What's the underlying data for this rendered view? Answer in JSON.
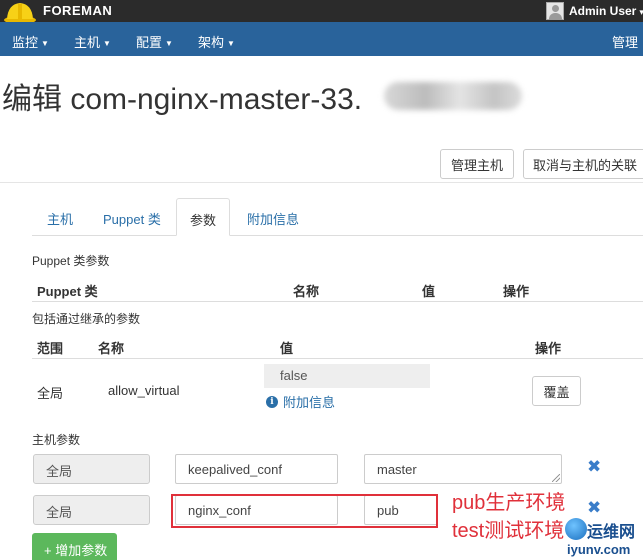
{
  "header": {
    "brand": "FOREMAN",
    "user": "Admin User"
  },
  "nav": {
    "items": [
      "监控",
      "主机",
      "配置",
      "架构"
    ],
    "right": "管理"
  },
  "page": {
    "title": "编辑 com-nginx-master-33."
  },
  "actions": {
    "manage_host": "管理主机",
    "disassociate": "取消与主机的关联"
  },
  "tabs": [
    {
      "label": "主机",
      "active": false
    },
    {
      "label": "Puppet 类",
      "active": false
    },
    {
      "label": "参数",
      "active": true
    },
    {
      "label": "附加信息",
      "active": false
    }
  ],
  "puppet_params": {
    "section": "Puppet 类参数",
    "columns": [
      "Puppet 类",
      "名称",
      "值",
      "操作"
    ]
  },
  "inherited": {
    "section": "包括通过继承的参数",
    "columns": [
      "范围",
      "名称",
      "值",
      "操作"
    ],
    "rows": [
      {
        "scope": "全局",
        "name": "allow_virtual",
        "value": "false",
        "info": "附加信息",
        "action": "覆盖"
      }
    ]
  },
  "host_params": {
    "section": "主机参数",
    "rows": [
      {
        "scope": "全局",
        "name": "keepalived_conf",
        "value": "master"
      },
      {
        "scope": "全局",
        "name": "nginx_conf",
        "value": "pub"
      }
    ],
    "add_label": "+ 增加参数"
  },
  "annotation": {
    "line1": "pub生产环境",
    "line2": "test测试环境"
  },
  "watermark": {
    "top": "运维网",
    "bottom": "iyunv.com"
  },
  "colors": {
    "navbar": "#29639b",
    "brandbar": "#2b2b2b",
    "link": "#2a6fa8",
    "add_button": "#5cb85c",
    "annotation": "#e0303a"
  }
}
